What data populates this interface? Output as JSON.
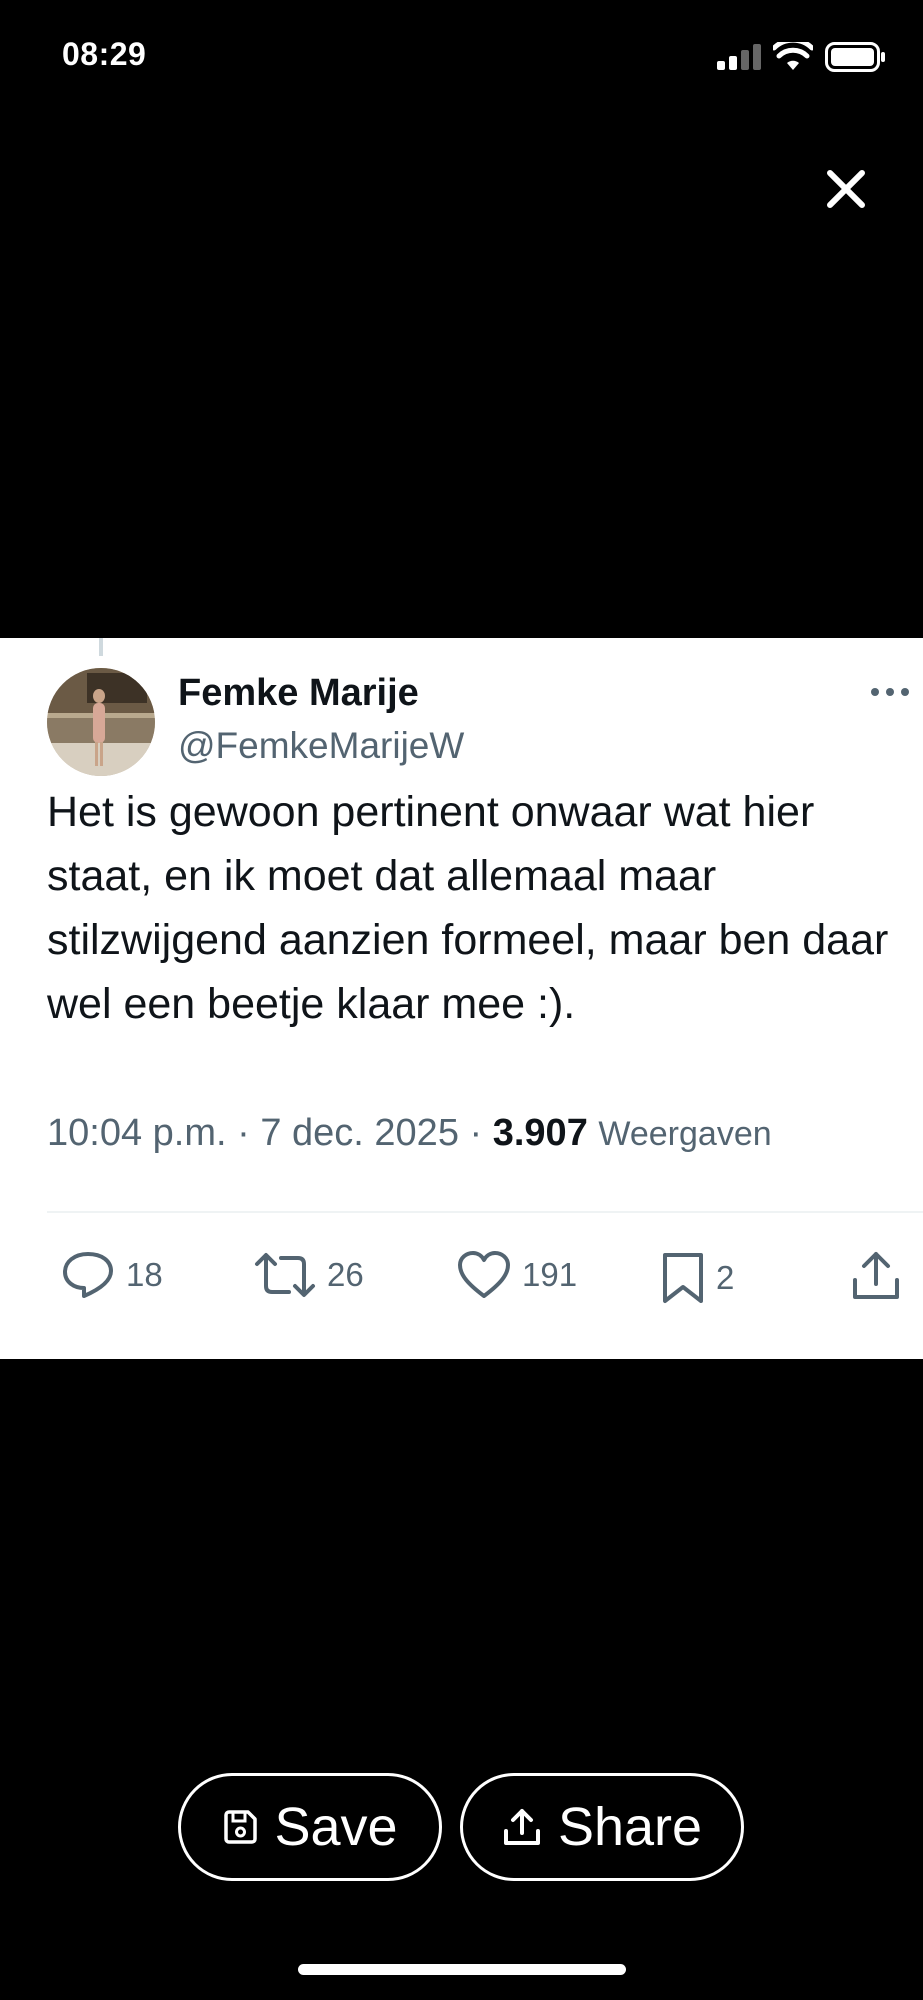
{
  "status_bar": {
    "time": "08:29",
    "icons": [
      "signal-icon",
      "wifi-icon",
      "battery-icon"
    ]
  },
  "viewer": {
    "close_icon": "close-icon"
  },
  "tweet": {
    "author_name": "Femke Marije",
    "author_handle": "@FemkeMarijeW",
    "text": "Het is gewoon pertinent onwaar wat hier staat, en ik moet dat allemaal maar stilzwijgend aanzien formeel, maar ben daar wel een beetje klaar mee :).",
    "time": "10:04 p.m.",
    "separator": "·",
    "date": "7 dec. 2025",
    "views": "3.907",
    "views_label": "Weergaven",
    "actions": {
      "replies": "18",
      "retweets": "26",
      "likes": "191",
      "bookmarks": "2"
    }
  },
  "bottom_actions": {
    "save_label": "Save",
    "share_label": "Share"
  },
  "colors": {
    "background": "#000000",
    "card": "#ffffff",
    "text_primary": "#0f1419",
    "text_secondary": "#536471"
  }
}
